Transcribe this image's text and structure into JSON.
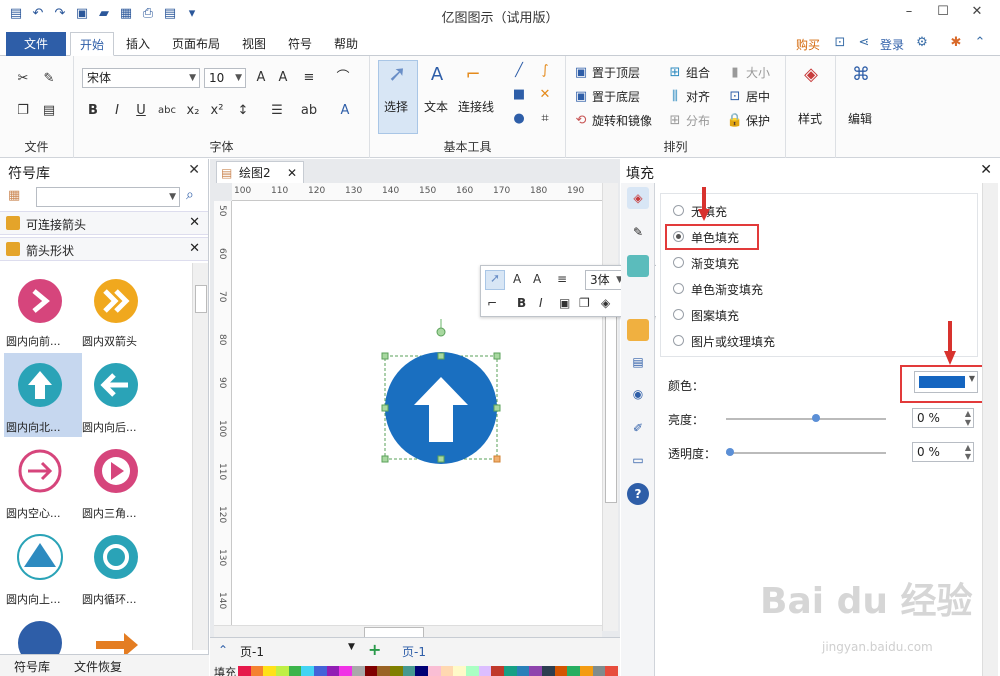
{
  "window": {
    "title": "亿图图示（试用版）"
  },
  "tabs": {
    "file": "文件",
    "items": [
      "开始",
      "插入",
      "页面布局",
      "视图",
      "符号",
      "帮助"
    ],
    "active": "开始",
    "buy": "购买",
    "login": "登录"
  },
  "ribbon": {
    "file_group": "文件",
    "font_group": "字体",
    "font_name": "宋体",
    "font_size": "10",
    "basic_tools_group": "基本工具",
    "select": "选择",
    "text": "文本",
    "connector": "连接线",
    "arrange_group": "排列",
    "bring_front": "置于顶层",
    "send_back": "置于底层",
    "rotate_mirror": "旋转和镜像",
    "combine": "组合",
    "align": "对齐",
    "distribute": "分布",
    "size": "大小",
    "center": "居中",
    "protect": "保护",
    "style": "样式",
    "edit": "编辑"
  },
  "library": {
    "title": "符号库",
    "categories": [
      "可连接箭头",
      "箭头形状"
    ],
    "shapes": [
      {
        "label": "圆内向前..."
      },
      {
        "label": "圆内双箭头"
      },
      {
        "label": "圆内向北..."
      },
      {
        "label": "圆内向后..."
      },
      {
        "label": "圆内空心..."
      },
      {
        "label": "圆内三角..."
      },
      {
        "label": "圆内向上..."
      },
      {
        "label": "圆内循环..."
      }
    ],
    "bottom_tabs": [
      "符号库",
      "文件恢复"
    ]
  },
  "canvas": {
    "doc_tab": "绘图2",
    "hruler": [
      "100",
      "110",
      "120",
      "130",
      "140",
      "150",
      "160",
      "170",
      "180",
      "190"
    ],
    "vruler": [
      "50",
      "60",
      "70",
      "80",
      "90",
      "100",
      "110",
      "120",
      "130",
      "140"
    ],
    "page_label": "页-1",
    "page_tab": "页-1",
    "fill_label": "填充",
    "font_short": "3体"
  },
  "fill_panel": {
    "title": "填充",
    "options": [
      "无填充",
      "单色填充",
      "渐变填充",
      "单色渐变填充",
      "图案填充",
      "图片或纹理填充"
    ],
    "selected": "单色填充",
    "color_label": "颜色：",
    "color_value": "#1565c0",
    "brightness_label": "亮度：",
    "brightness_value": "0 %",
    "transparency_label": "透明度：",
    "transparency_value": "0 %"
  },
  "watermark": {
    "main": "Bai du 经验",
    "url": "jingyan.baidu.com"
  }
}
